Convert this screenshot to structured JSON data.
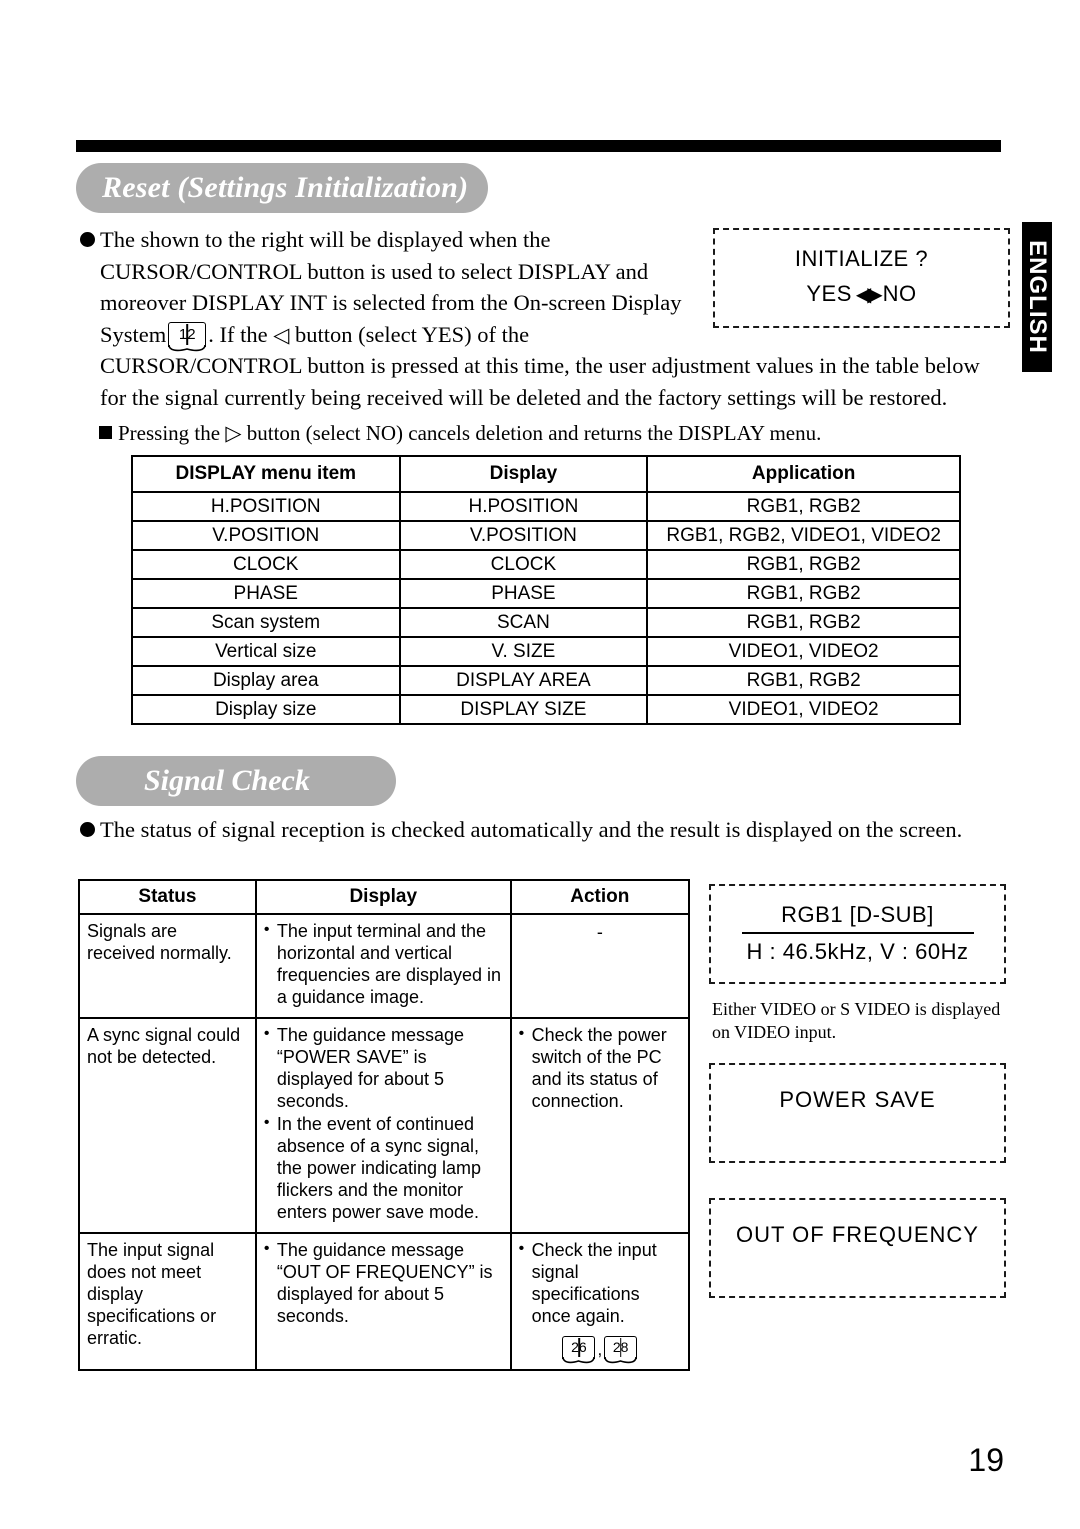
{
  "page": {
    "number": "19",
    "language_tab": "ENGLISH"
  },
  "sections": {
    "reset": {
      "heading": "Reset (Settings Initialization)",
      "paragraph_1": "The shown to the right will be displayed when the CURSOR/CONTROL button is used to select DISPLAY and moreover DISPLAY INT is selected from the On-screen Display System",
      "paragraph_1_ref": "12",
      "paragraph_1_cont": ". If the",
      "paragraph_1_arrow": "◁",
      "paragraph_1_cont2": "button (select YES) of the",
      "paragraph_2": "CURSOR/CONTROL button is pressed at this time, the user adjustment values in the table below for the signal currently being received will be deleted and the factory settings will be restored.",
      "note_pre": "Pressing the",
      "note_arrow": "▷",
      "note_post": "button (select NO) cancels deletion and returns the DISPLAY menu."
    },
    "signal_check": {
      "heading": "Signal Check",
      "paragraph_1": "The status of signal reception is checked automatically and the result is displayed on the screen."
    }
  },
  "osd_boxes": {
    "initialize": {
      "line1": "INITIALIZE ?",
      "yes": "YES",
      "arrows": "◀▶",
      "no": "NO"
    },
    "rgb1": {
      "line1": "RGB1  [D-SUB]",
      "line2": "H : 46.5kHz, V : 60Hz"
    },
    "power_save": {
      "line1": "POWER  SAVE"
    },
    "out_of_frequency": {
      "line1": "OUT OF FREQUENCY"
    },
    "note": "Either VIDEO or S VIDEO is displayed on VIDEO input."
  },
  "display_table": {
    "headers": [
      "DISPLAY menu item",
      "Display",
      "Application"
    ],
    "rows": [
      [
        "H.POSITION",
        "H.POSITION",
        "RGB1, RGB2"
      ],
      [
        "V.POSITION",
        "V.POSITION",
        "RGB1, RGB2, VIDEO1, VIDEO2"
      ],
      [
        "CLOCK",
        "CLOCK",
        "RGB1, RGB2"
      ],
      [
        "PHASE",
        "PHASE",
        "RGB1, RGB2"
      ],
      [
        "Scan system",
        "SCAN",
        "RGB1, RGB2"
      ],
      [
        "Vertical size",
        "V. SIZE",
        "VIDEO1, VIDEO2"
      ],
      [
        "Display area",
        "DISPLAY AREA",
        "RGB1, RGB2"
      ],
      [
        "Display size",
        "DISPLAY SIZE",
        "VIDEO1, VIDEO2"
      ]
    ]
  },
  "signal_table": {
    "headers": [
      "Status",
      "Display",
      "Action"
    ],
    "rows": [
      {
        "status": "Signals are received normally.",
        "display": [
          "The input terminal and the horizontal and vertical frequencies are displayed in a guidance image."
        ],
        "action": [],
        "action_dash": "-",
        "refs": []
      },
      {
        "status": "A sync signal could not be detected.",
        "display": [
          "The guidance message “POWER SAVE” is displayed for about 5 seconds.",
          "In the event of continued absence of a sync signal, the power indicating lamp flickers and the monitor enters power save mode."
        ],
        "action": [
          "Check the power switch of the PC and its status of connection."
        ],
        "action_dash": "",
        "refs": []
      },
      {
        "status": "The input signal does not meet display specifications or erratic.",
        "display": [
          "The guidance message “OUT OF FREQUENCY” is displayed for about 5 seconds."
        ],
        "action": [
          "Check the input signal specifications once again."
        ],
        "action_dash": "",
        "refs": [
          "26",
          "28"
        ]
      }
    ]
  }
}
